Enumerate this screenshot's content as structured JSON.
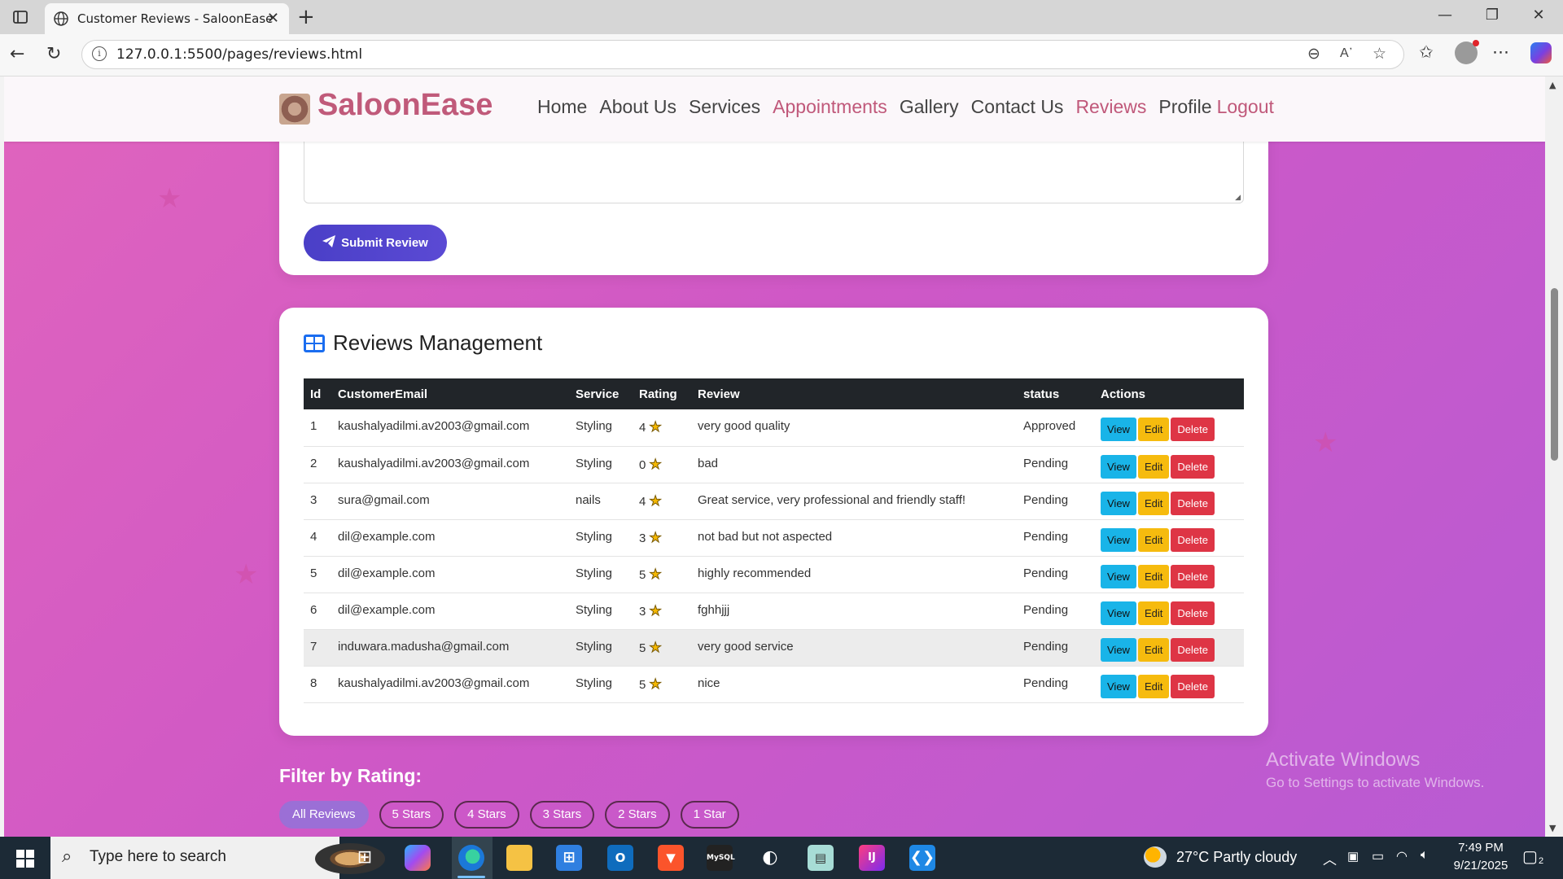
{
  "browser": {
    "tab_title": "Customer Reviews - SaloonEase",
    "url": "127.0.0.1:5500/pages/reviews.html"
  },
  "site": {
    "brand": "SaloonEase",
    "nav": [
      {
        "label": "Home",
        "highlight": false
      },
      {
        "label": "About Us",
        "highlight": false
      },
      {
        "label": "Services",
        "highlight": false
      },
      {
        "label": "Appointments",
        "highlight": true
      },
      {
        "label": "Gallery",
        "highlight": false
      },
      {
        "label": "Contact Us",
        "highlight": false
      },
      {
        "label": "Reviews",
        "highlight": true
      },
      {
        "label": "Profile",
        "highlight": false
      },
      {
        "label": "Logout",
        "highlight": true
      }
    ]
  },
  "review_form": {
    "submit_label": "Submit Review"
  },
  "reviews": {
    "title": "Reviews Management",
    "columns": [
      "Id",
      "CustomerEmail",
      "Service",
      "Rating",
      "Review",
      "status",
      "Actions"
    ],
    "action_labels": {
      "view": "View",
      "edit": "Edit",
      "delete": "Delete"
    },
    "rows": [
      {
        "id": "1",
        "email": "kaushalyadilmi.av2003@gmail.com",
        "service": "Styling",
        "rating": "4",
        "review": "very good quality",
        "status": "Approved"
      },
      {
        "id": "2",
        "email": "kaushalyadilmi.av2003@gmail.com",
        "service": "Styling",
        "rating": "0",
        "review": "bad",
        "status": "Pending"
      },
      {
        "id": "3",
        "email": "sura@gmail.com",
        "service": "nails",
        "rating": "4",
        "review": "Great service, very professional and friendly staff!",
        "status": "Pending"
      },
      {
        "id": "4",
        "email": "dil@example.com",
        "service": "Styling",
        "rating": "3",
        "review": "not bad but not aspected",
        "status": "Pending"
      },
      {
        "id": "5",
        "email": "dil@example.com",
        "service": "Styling",
        "rating": "5",
        "review": "highly recommended",
        "status": "Pending"
      },
      {
        "id": "6",
        "email": "dil@example.com",
        "service": "Styling",
        "rating": "3",
        "review": "fghhjjj",
        "status": "Pending"
      },
      {
        "id": "7",
        "email": "induwara.madusha@gmail.com",
        "service": "Styling",
        "rating": "5",
        "review": "very good service",
        "status": "Pending"
      },
      {
        "id": "8",
        "email": "kaushalyadilmi.av2003@gmail.com",
        "service": "Styling",
        "rating": "5",
        "review": "nice",
        "status": "Pending"
      }
    ]
  },
  "filter": {
    "title": "Filter by Rating:",
    "options": [
      "All Reviews",
      "5 Stars",
      "4 Stars",
      "3 Stars",
      "2 Stars",
      "1 Star"
    ],
    "active": "All Reviews"
  },
  "watermark": {
    "line1": "Activate Windows",
    "line2": "Go to Settings to activate Windows."
  },
  "taskbar": {
    "search_placeholder": "Type here to search",
    "weather": "27°C  Partly cloudy",
    "time": "7:49 PM",
    "date": "9/21/2025",
    "notification_count": "2"
  },
  "colors": {
    "brand": "#c05a7a",
    "submit": "#4a3fc7",
    "view": "#19b4e8",
    "edit": "#f6bb0e",
    "delete": "#de3545",
    "table_header": "#212529"
  }
}
